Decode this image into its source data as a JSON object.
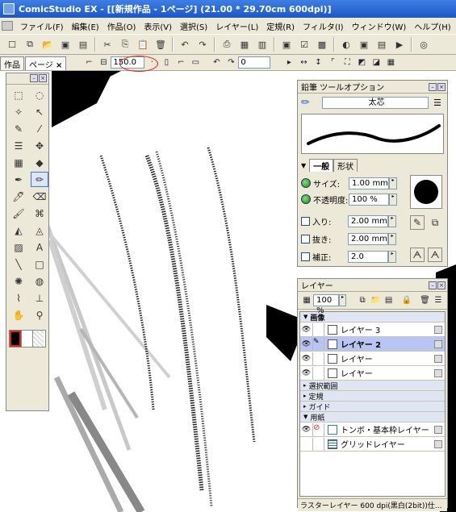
{
  "window": {
    "title": "ComicStudio EX - [[新規作品 - 1ページ] (21.00 * 29.70cm 600dpi)]"
  },
  "menu": {
    "items": [
      "ファイル(F)",
      "編集(E)",
      "作品(O)",
      "表示(V)",
      "選択(S)",
      "レイヤー(L)",
      "定規(R)",
      "フィルタ(I)",
      "ウィンドウ(W)",
      "ヘルプ(H)"
    ]
  },
  "tabs": {
    "work": "作品",
    "page": "ページ",
    "close": "×"
  },
  "view": {
    "zoom": "150.0",
    "rotation": "0"
  },
  "pencil_panel": {
    "title": "鉛筆 ツールオプション",
    "preset": "太芯",
    "tab_general": "一般",
    "tab_shape": "形状",
    "size_label": "サイズ:",
    "size_value": "1.00 mm",
    "opacity_label": "不透明度:",
    "opacity_value": "100 %",
    "in_label": "入り:",
    "in_value": "2.00 mm",
    "out_label": "抜き:",
    "out_value": "2.00 mm",
    "correction_label": "補正:",
    "correction_value": "2.0"
  },
  "layer_panel": {
    "title": "レイヤー",
    "opacity": "100 %",
    "group_image": "画像",
    "layers": [
      {
        "name": "レイヤー 3"
      },
      {
        "name": "レイヤー 2"
      },
      {
        "name": "レイヤー"
      },
      {
        "name": "レイヤー"
      }
    ],
    "group_selection": "選択範囲",
    "group_ruler": "定規",
    "group_guide": "ガイド",
    "group_paper": "用紙",
    "paper_layers": [
      {
        "name": "トンボ・基本枠レイヤー"
      },
      {
        "name": "グリッドレイヤー"
      }
    ],
    "status": "ラスターレイヤー 600 dpi(黒白(2bit))仕..."
  },
  "colors": {
    "accent": "#2a5bd0",
    "highlight": "#b9c6f4",
    "annotation": "#dd2222"
  }
}
